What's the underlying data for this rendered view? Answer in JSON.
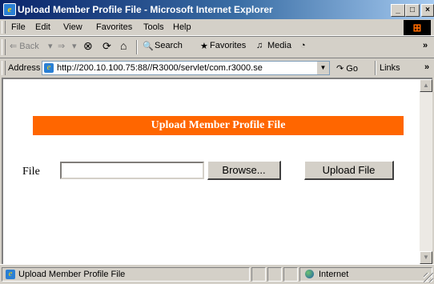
{
  "window": {
    "title": "Upload Member Profile File - Microsoft Internet Explorer",
    "controls": {
      "minimize": "_",
      "maximize": "□",
      "close": "×"
    }
  },
  "menu": [
    "File",
    "Edit",
    "View",
    "Favorites",
    "Tools",
    "Help"
  ],
  "toolbar": {
    "back": "⇐ Back",
    "back_dd": "▾",
    "forward": "⇒",
    "forward_dd": "▾",
    "stop": "⊗",
    "refresh": "⟳",
    "home": "⌂",
    "search": "Search",
    "favorites": "Favorites",
    "media": "Media",
    "overflow": "»"
  },
  "address": {
    "label": "Address",
    "url": "http://200.10.100.75:88//R3000/servlet/com.r3000.se",
    "go": "Go",
    "links": "Links",
    "links_overflow": "»"
  },
  "page": {
    "banner": "Upload Member Profile File",
    "file_label": "File",
    "file_value": "",
    "browse_label": "Browse...",
    "upload_label": "Upload File"
  },
  "status": {
    "text": "Upload Member Profile File",
    "zone": "Internet"
  },
  "colors": {
    "banner_bg": "#ff6600",
    "title_bg": "#0a246a",
    "chrome": "#d4d0c8"
  }
}
